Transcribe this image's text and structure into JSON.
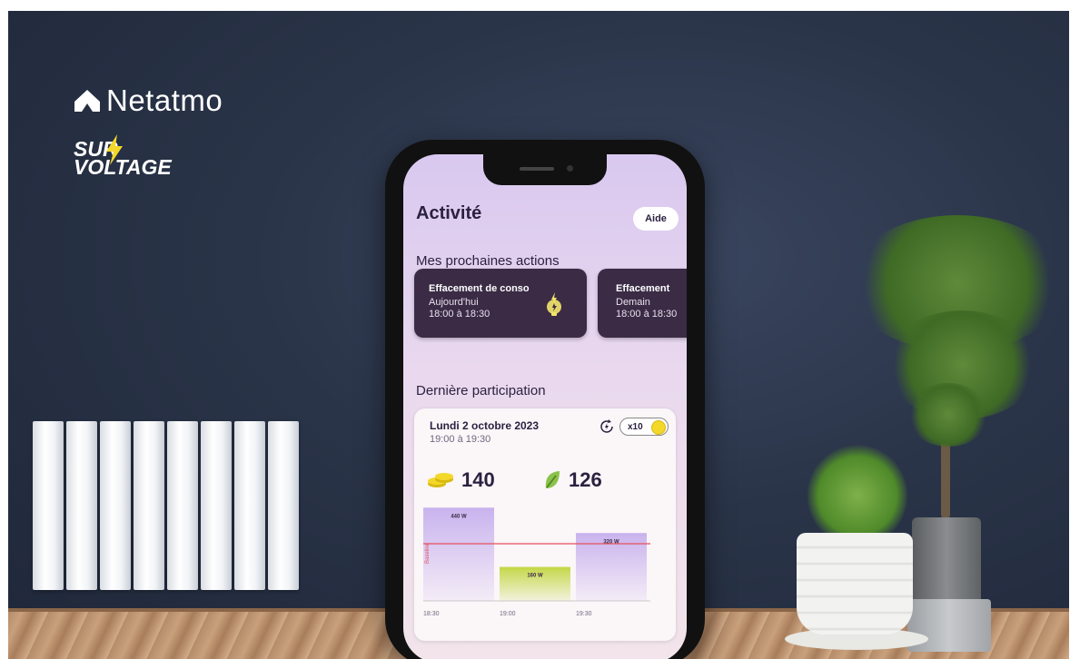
{
  "brand": {
    "netatmo": "Netatmo",
    "survoltage_line1": "SUR",
    "survoltage_line2": "VOLTAGE"
  },
  "app": {
    "title": "Activité",
    "help_label": "Aide",
    "next_actions_heading": "Mes prochaines actions",
    "actions": [
      {
        "title": "Effacement de conso",
        "day": "Aujourd'hui",
        "hours": "18:00 à 18:30",
        "icon": "lightbulb-bolt-icon"
      },
      {
        "title": "Effacement",
        "day": "Demain",
        "hours": "18:00 à 18:30"
      }
    ],
    "last_participation_heading": "Dernière participation",
    "participation": {
      "date": "Lundi 2 octobre 2023",
      "hours": "19:00 à 19:30",
      "multiplier": "x10",
      "coins": "140",
      "eco": "126"
    }
  },
  "colors": {
    "card_dark": "#3b2b45",
    "accent_purple": "#c9b3ee",
    "accent_green": "#c5d84a",
    "baseline_red": "#e8505b",
    "coin_yellow": "#f3d82a"
  },
  "chart_data": {
    "type": "bar",
    "categories": [
      "18:30",
      "19:00",
      "19:30"
    ],
    "values": [
      440,
      160,
      320
    ],
    "value_labels": [
      "440 W",
      "160 W",
      "320 W"
    ],
    "x_ticks": [
      "18:30",
      "19:00",
      "19:30"
    ],
    "baseline_label": "Baseline",
    "baseline": 270,
    "ylim": [
      0,
      480
    ],
    "bar_colors": [
      "#c9b3ee",
      "#c5d84a",
      "#c9b3ee"
    ]
  }
}
